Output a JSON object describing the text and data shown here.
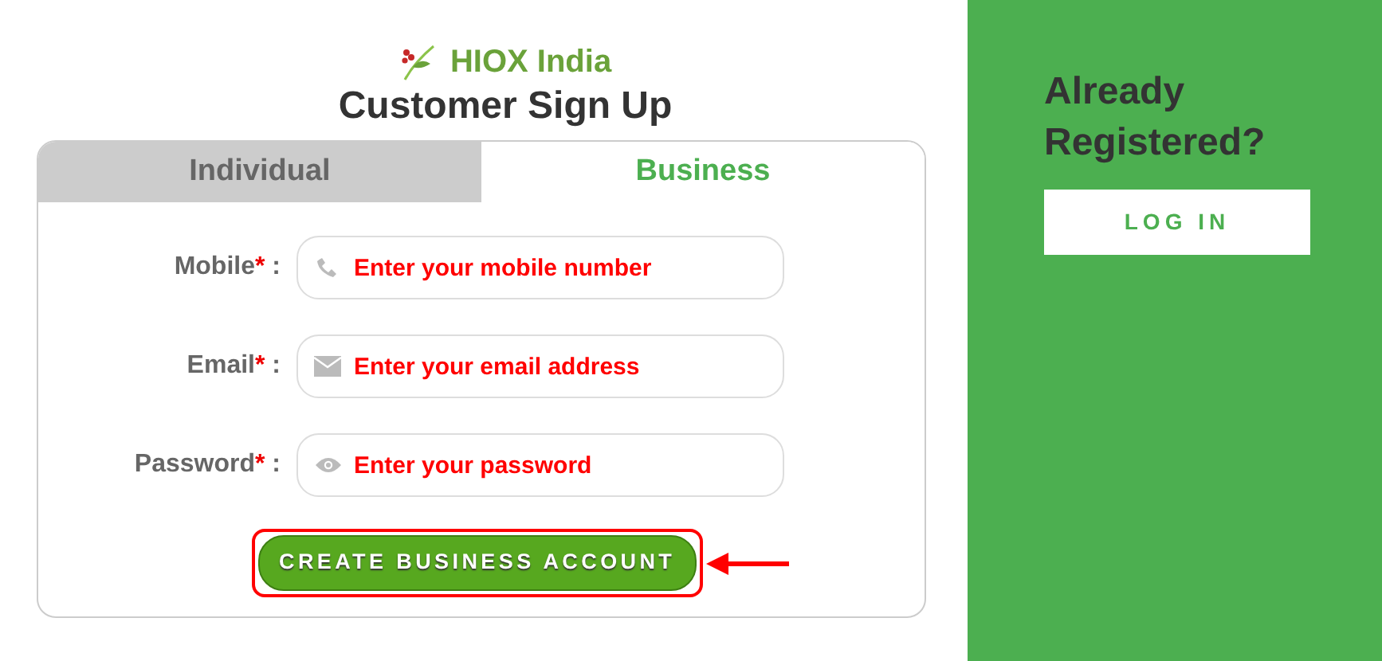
{
  "brand": {
    "name": "HIOX India"
  },
  "title": "Customer Sign Up",
  "tabs": [
    {
      "label": "Individual",
      "selected": false
    },
    {
      "label": "Business",
      "selected": true
    }
  ],
  "fields": [
    {
      "label": "Mobile",
      "required_mark": "*",
      "separator": ":",
      "kind": "phone",
      "placeholder": "Enter your mobile number"
    },
    {
      "label": "Email",
      "required_mark": "*",
      "separator": ":",
      "kind": "email",
      "placeholder": "Enter your email address"
    },
    {
      "label": "Password",
      "required_mark": "*",
      "separator": ":",
      "kind": "password",
      "placeholder": "Enter your password"
    }
  ],
  "submit": {
    "label": "CREATE BUSINESS ACCOUNT",
    "highlighted": true
  },
  "side": {
    "heading": "Already Registered?",
    "button": "LOG IN"
  }
}
